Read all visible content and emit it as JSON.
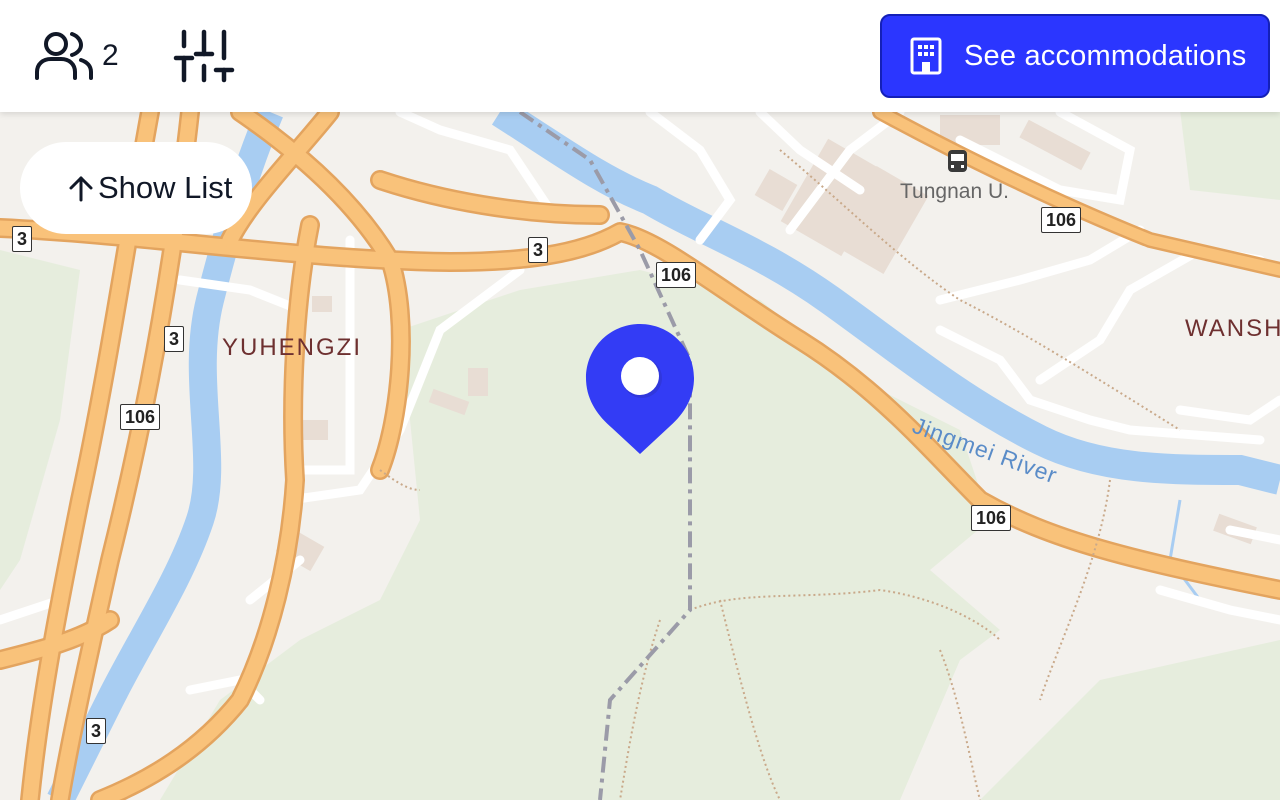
{
  "header": {
    "guest_count": "2",
    "accommodations_label": "See accommodations"
  },
  "show_list": {
    "label": "Show List"
  },
  "map": {
    "places": [
      {
        "name": "YUHENGZI"
      },
      {
        "name": "WANSH"
      },
      {
        "name": "Tungnan U."
      },
      {
        "name": "Jingmei River"
      }
    ],
    "road_shields": [
      "3",
      "3",
      "3",
      "3",
      "106",
      "106",
      "106",
      "106"
    ]
  },
  "colors": {
    "accent": "#2b36ff",
    "pin": "#333cf5",
    "road": "#f9c27a",
    "road_border": "#e3a45f",
    "river": "#a8cdf2",
    "park": "#e6eddd",
    "land": "#f3f1ed"
  },
  "icons": {
    "guests": "users-icon",
    "filters": "sliders-icon",
    "accommodations": "building-icon",
    "show_list": "arrow-up-icon",
    "bus_stop": "bus-icon",
    "map_pin": "map-pin-icon"
  }
}
